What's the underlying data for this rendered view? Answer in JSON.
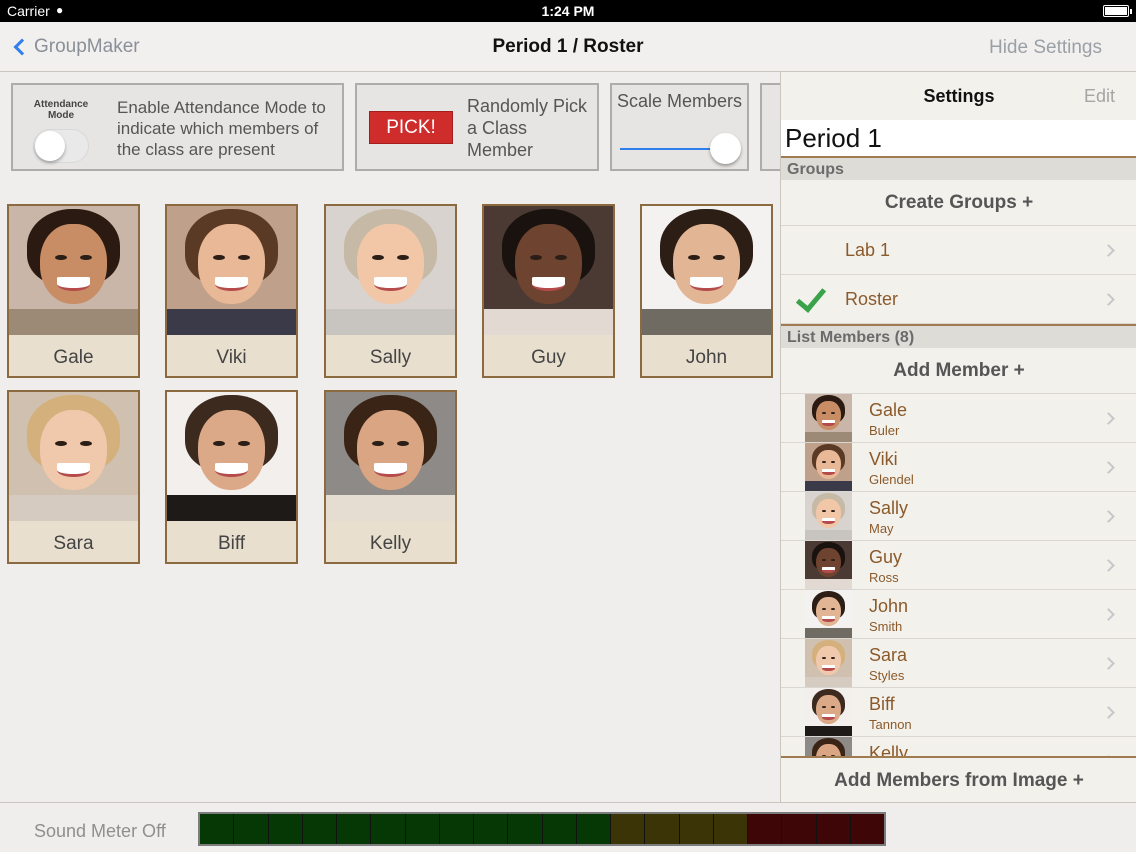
{
  "status_bar": {
    "carrier": "Carrier",
    "time": "1:24 PM"
  },
  "nav": {
    "back_label": "GroupMaker",
    "title": "Period 1 / Roster",
    "right_label": "Hide Settings"
  },
  "toolbar": {
    "attendance_label": "Attendance Mode",
    "attendance_desc": "Enable Attendance Mode to indicate which members of the class are present",
    "attendance_on": false,
    "pick_button": "PICK!",
    "pick_desc": "Randomly Pick a Class Member",
    "scale_label": "Scale Members",
    "scale_level": 1.0
  },
  "tiles": [
    {
      "name": "Gale",
      "skin": "#c98d66",
      "hair": "#2a1a12",
      "bg": "#c9b6a8",
      "shirt": "#9c8a76"
    },
    {
      "name": "Viki",
      "skin": "#e9b896",
      "hair": "#5a3a24",
      "bg": "#bfa08a",
      "shirt": "#3a3a48"
    },
    {
      "name": "Sally",
      "skin": "#f1c7a8",
      "hair": "#c6b9a6",
      "bg": "#d8d3cf",
      "shirt": "#c8c4c0"
    },
    {
      "name": "Guy",
      "skin": "#6e4330",
      "hair": "#1a120e",
      "bg": "#4b3a34",
      "shirt": "#e2dad2"
    },
    {
      "name": "John",
      "skin": "#e2b594",
      "hair": "#2c1d15",
      "bg": "#f4f2f0",
      "shirt": "#6f6a62"
    },
    {
      "name": "Sara",
      "skin": "#f0c8ac",
      "hair": "#d4b07c",
      "bg": "#cfc0b0",
      "shirt": "#d6cbc0"
    },
    {
      "name": "Biff",
      "skin": "#dba888",
      "hair": "#3c2a1e",
      "bg": "#f2efec",
      "shirt": "#1e1a18"
    },
    {
      "name": "Kelly",
      "skin": "#d9a583",
      "hair": "#3a2416",
      "bg": "#8d8a88",
      "shirt": "#e6ddd2"
    }
  ],
  "settings": {
    "title": "Settings",
    "edit_label": "Edit",
    "name_value": "Period 1",
    "groups_header": "Groups",
    "create_groups": "Create Groups +",
    "groups": [
      {
        "label": "Lab 1",
        "checked": false
      },
      {
        "label": "Roster",
        "checked": true
      }
    ],
    "members_header": "List Members (8)",
    "add_member": "Add Member +",
    "members": [
      {
        "first": "Gale",
        "last": "Buler"
      },
      {
        "first": "Viki",
        "last": "Glendel"
      },
      {
        "first": "Sally",
        "last": "May"
      },
      {
        "first": "Guy",
        "last": "Ross"
      },
      {
        "first": "John",
        "last": "Smith"
      },
      {
        "first": "Sara",
        "last": "Styles"
      },
      {
        "first": "Biff",
        "last": "Tannon"
      },
      {
        "first": "Kelly",
        "last": ""
      }
    ],
    "add_from_image": "Add Members from Image +"
  },
  "sound": {
    "label": "Sound Meter Off",
    "colors": {
      "green": "#063806",
      "yellow": "#3a3406",
      "red": "#3e0606"
    },
    "segments": [
      "green",
      "green",
      "green",
      "green",
      "green",
      "green",
      "green",
      "green",
      "green",
      "green",
      "green",
      "green",
      "yellow",
      "yellow",
      "yellow",
      "yellow",
      "red",
      "red",
      "red",
      "red"
    ]
  }
}
